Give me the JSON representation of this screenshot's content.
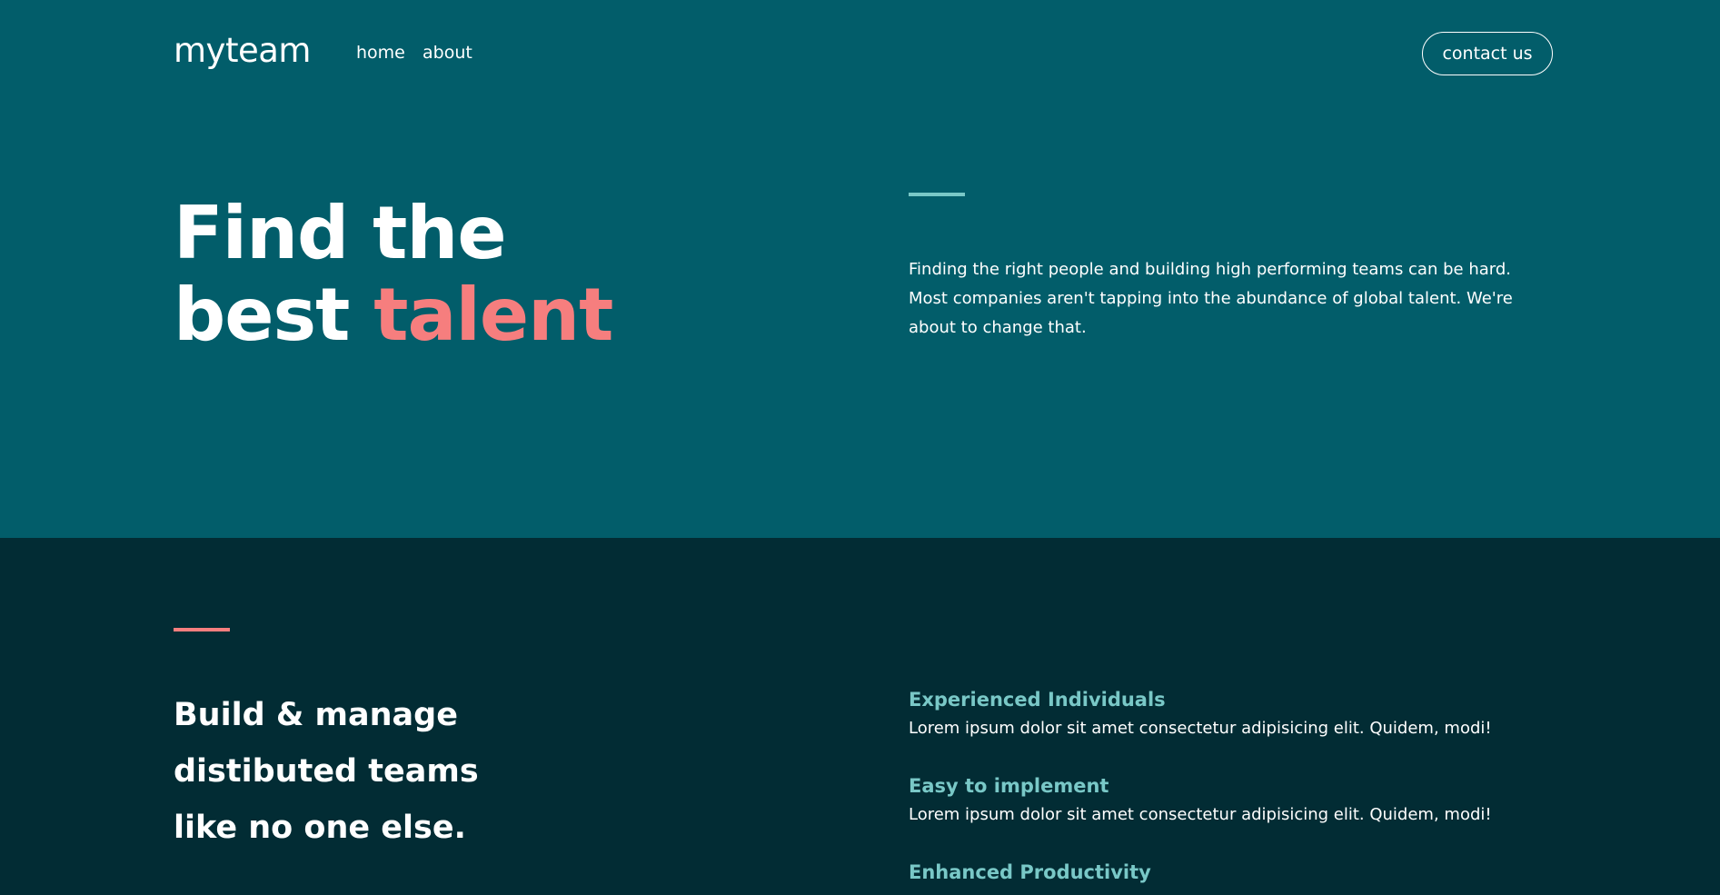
{
  "header": {
    "logo": "myteam",
    "nav": [
      {
        "label": "home"
      },
      {
        "label": "about"
      }
    ],
    "cta_label": "contact us"
  },
  "hero": {
    "title_line1": "Find the",
    "title_line2_plain": "best",
    "title_line2_accent": "talent",
    "description": "Finding the right people and building high performing teams can be hard. Most companies aren't tapping into the abundance of global talent. We're about to change that."
  },
  "features_section": {
    "title_line1": "Build & manage",
    "title_line2": "distibuted teams",
    "title_line3": "like no one else.",
    "items": [
      {
        "title": "Experienced Individuals",
        "description": "Lorem ipsum dolor sit amet consectetur adipisicing elit. Quidem, modi!"
      },
      {
        "title": "Easy to implement",
        "description": "Lorem ipsum dolor sit amet consectetur adipisicing elit. Quidem, modi!"
      },
      {
        "title": "Enhanced Productivity",
        "description": ""
      }
    ]
  },
  "colors": {
    "hero_bg": "#025d6a",
    "section_bg": "#022c34",
    "accent_coral": "#f67e7e",
    "accent_teal": "#79c8c7",
    "text": "#ffffff"
  }
}
